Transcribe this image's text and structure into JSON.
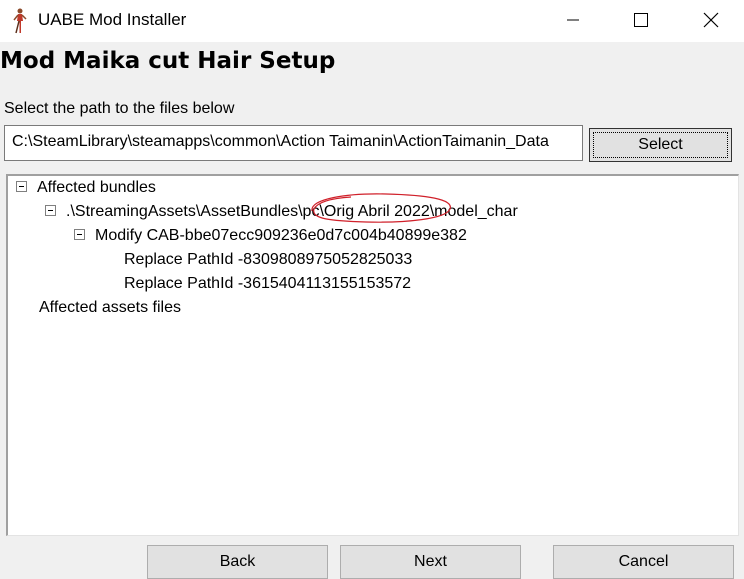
{
  "window": {
    "title": "UABE Mod Installer",
    "icon": "figure-icon"
  },
  "header": {
    "title": "Mod Maika cut Hair Setup"
  },
  "path": {
    "label": "Select the path to the files below",
    "value": "C:\\SteamLibrary\\steamapps\\common\\Action Taimanin\\ActionTaimanin_Data",
    "select_label": "Select"
  },
  "tree": {
    "affected_bundles": "Affected bundles",
    "bundle_path": ".\\StreamingAssets\\AssetBundles\\pc\\Orig Abril 2022\\model_char",
    "modify": "Modify CAB-bbe07ecc909236e0d7c004b40899e382",
    "replace_1": "Replace PathId -8309808975052825033",
    "replace_2": "Replace PathId -3615404113155153572",
    "affected_assets": "Affected assets files"
  },
  "buttons": {
    "back": "Back",
    "next": "Next",
    "cancel": "Cancel"
  },
  "colors": {
    "annotation": "#d0202a",
    "window_bg": "#f0f0f0",
    "button_bg": "#e1e1e1"
  }
}
